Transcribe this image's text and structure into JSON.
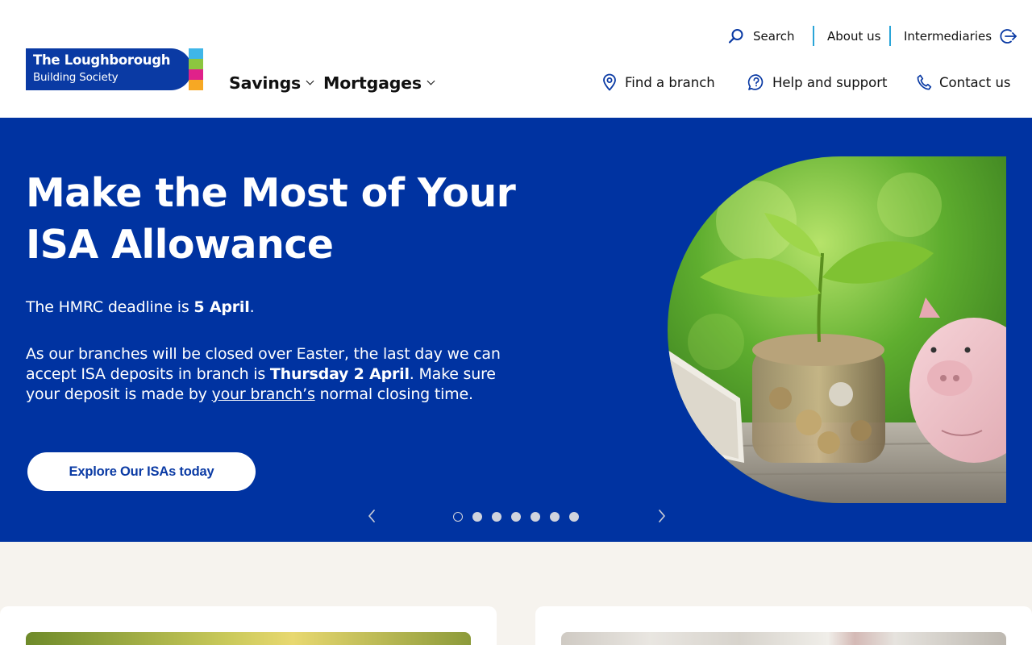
{
  "logo": {
    "line1": "The Loughborough",
    "line2": "Building Society",
    "bar_colors": [
      "#3fb6e8",
      "#8cc63f",
      "#e0218a",
      "#f7a823"
    ]
  },
  "utility_nav": {
    "search": "Search",
    "about": "About us",
    "intermediaries": "Intermediaries"
  },
  "main_nav": [
    {
      "label": "Savings"
    },
    {
      "label": "Mortgages"
    }
  ],
  "secondary_nav": {
    "find_branch": "Find a branch",
    "help": "Help and support",
    "contact": "Contact us"
  },
  "hero": {
    "title": "Make the Most of Your ISA Allowance",
    "p1_prefix": "The HMRC deadline is ",
    "p1_bold": "5 April",
    "p1_suffix": ".",
    "p2_part1": "As our branches will be closed over Easter, the last day we can accept ISA deposits in branch is ",
    "p2_bold": "Thursday 2 April",
    "p2_part2": ". Make sure your deposit is made by ",
    "p2_link": "your branch’s",
    "p2_part3": " normal closing time.",
    "cta": "Explore Our ISAs today",
    "image_icon": "plant-coins-piggy-bank-image"
  },
  "carousel": {
    "slide_count": 7,
    "active_index": 0
  },
  "colors": {
    "brand_blue": "#0033a1",
    "logo_blue": "#0a3aa4",
    "separator": "#2aa5d8",
    "section_bg": "#f6f3ee"
  }
}
